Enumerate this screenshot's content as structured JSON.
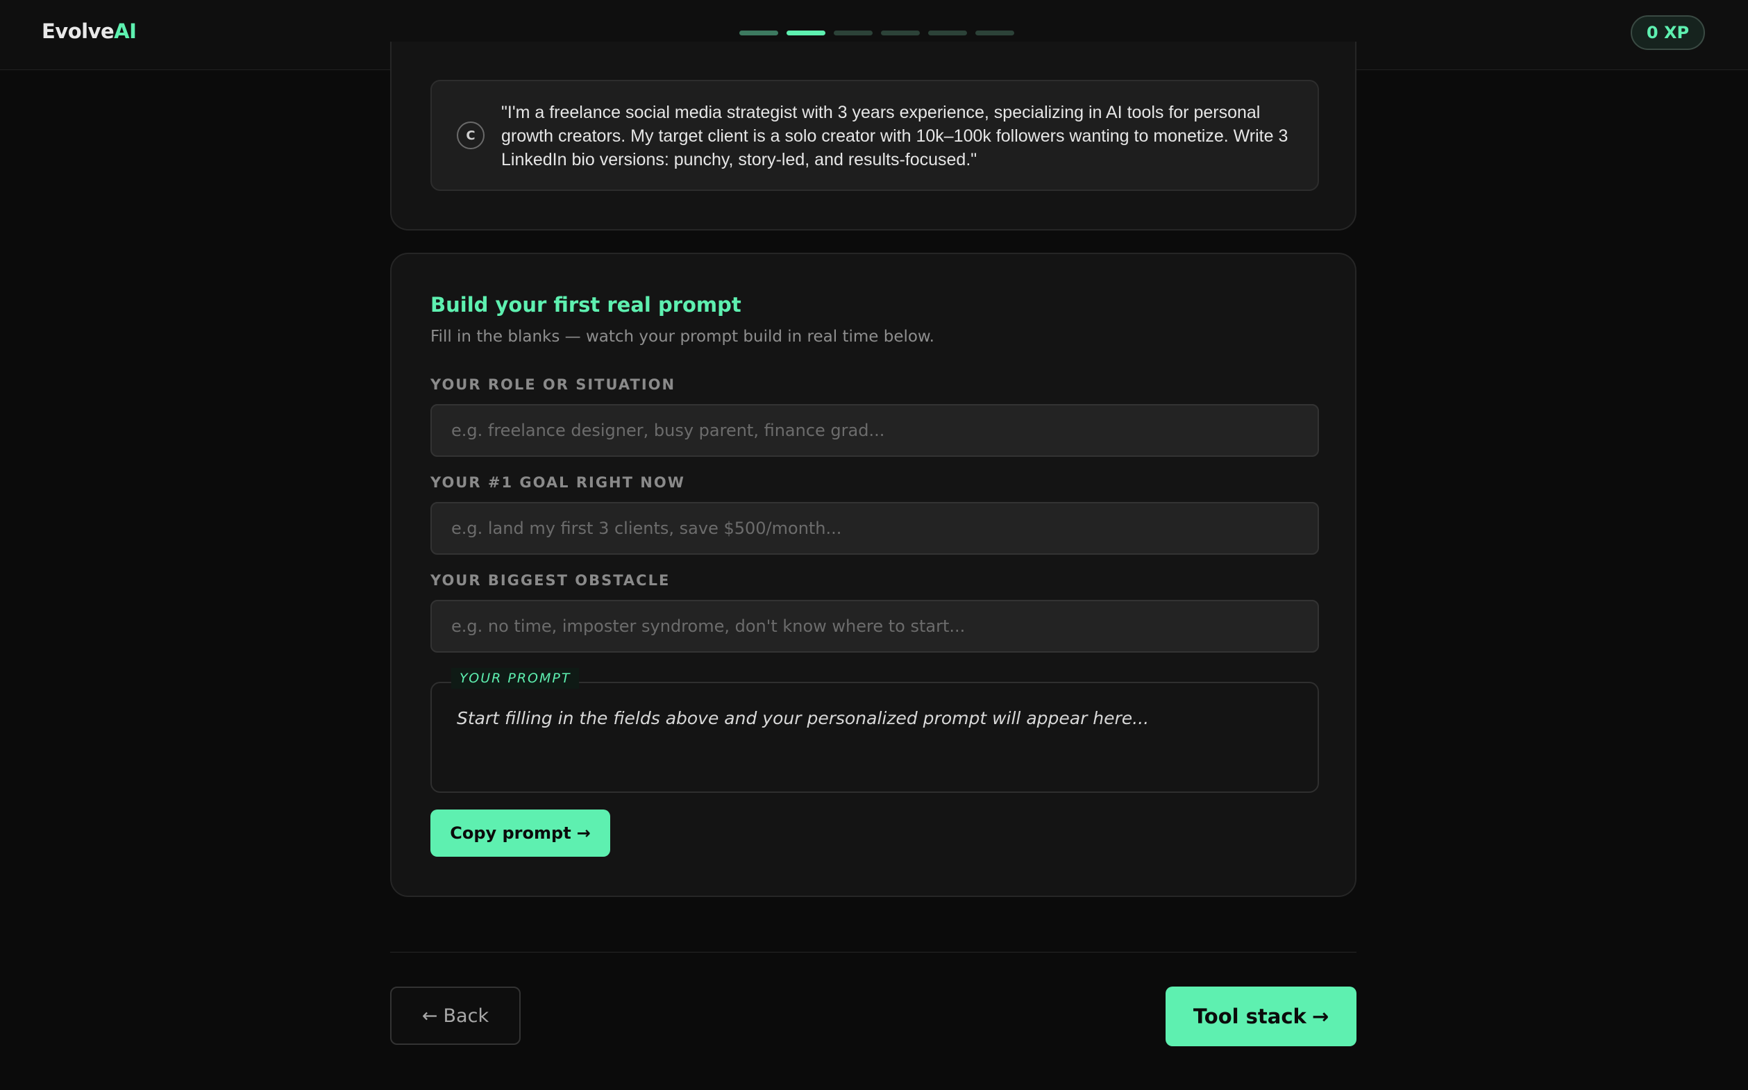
{
  "header": {
    "logo_part1": "Evolve",
    "logo_part2": "AI",
    "progress": {
      "total_steps": 6,
      "current_step": 2
    },
    "xp_label": "0 XP"
  },
  "example_option": {
    "badge": "C",
    "text": "\"I'm a freelance social media strategist with 3 years experience, specializing in AI tools for personal growth creators. My target client is a solo creator with 10k–100k followers wanting to monetize. Write 3 LinkedIn bio versions: punchy, story-led, and results-focused.\""
  },
  "builder": {
    "title": "Build your first real prompt",
    "subtitle": "Fill in the blanks — watch your prompt build in real time below.",
    "fields": [
      {
        "label": "YOUR ROLE OR SITUATION",
        "placeholder": "e.g. freelance designer, busy parent, finance grad...",
        "value": ""
      },
      {
        "label": "YOUR #1 GOAL RIGHT NOW",
        "placeholder": "e.g. land my first 3 clients, save $500/month...",
        "value": ""
      },
      {
        "label": "YOUR BIGGEST OBSTACLE",
        "placeholder": "e.g. no time, imposter syndrome, don't know where to start...",
        "value": ""
      }
    ],
    "prompt_tag": "YOUR PROMPT",
    "prompt_placeholder": "Start filling in the fields above and your personalized prompt will appear here...",
    "copy_label": "Copy prompt",
    "copy_arrow": "→"
  },
  "nav": {
    "back_arrow": "←",
    "back_label": "Back",
    "next_label": "Tool stack",
    "next_arrow": "→"
  },
  "colors": {
    "accent": "#5ef0b0",
    "background": "#0b0b0b",
    "card": "#141414"
  }
}
